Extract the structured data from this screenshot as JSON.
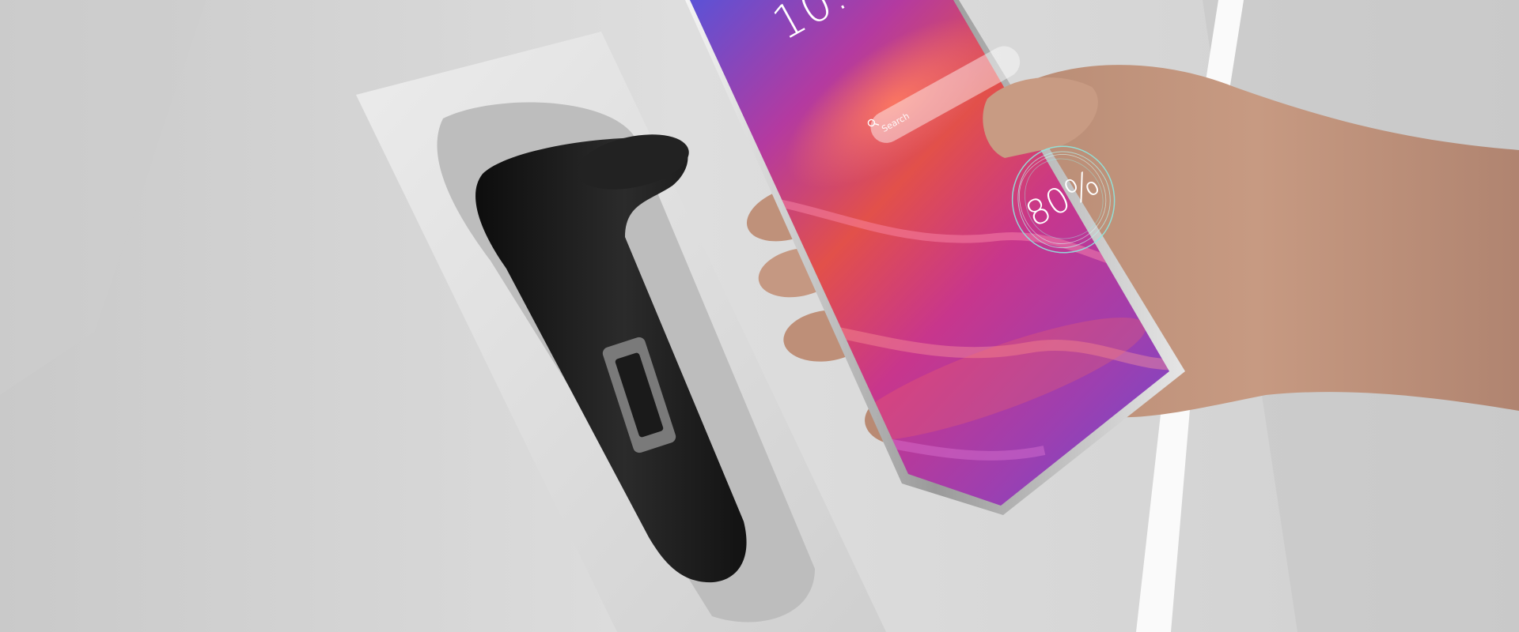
{
  "phone": {
    "clock_text": "10:",
    "search_placeholder": "Search",
    "battery_percent_text": "80%",
    "battery_level_percent": 80
  },
  "icons": {
    "search": "search-icon",
    "fingerprint": "fingerprint-icon"
  },
  "colors": {
    "screen_magenta": "#c2338a",
    "screen_violet": "#7a4fd0",
    "screen_red": "#e0453d",
    "background_gray": "#d6d6d6",
    "handle_black": "#1a1a1a",
    "ring_cyan": "#8ee8e0"
  }
}
